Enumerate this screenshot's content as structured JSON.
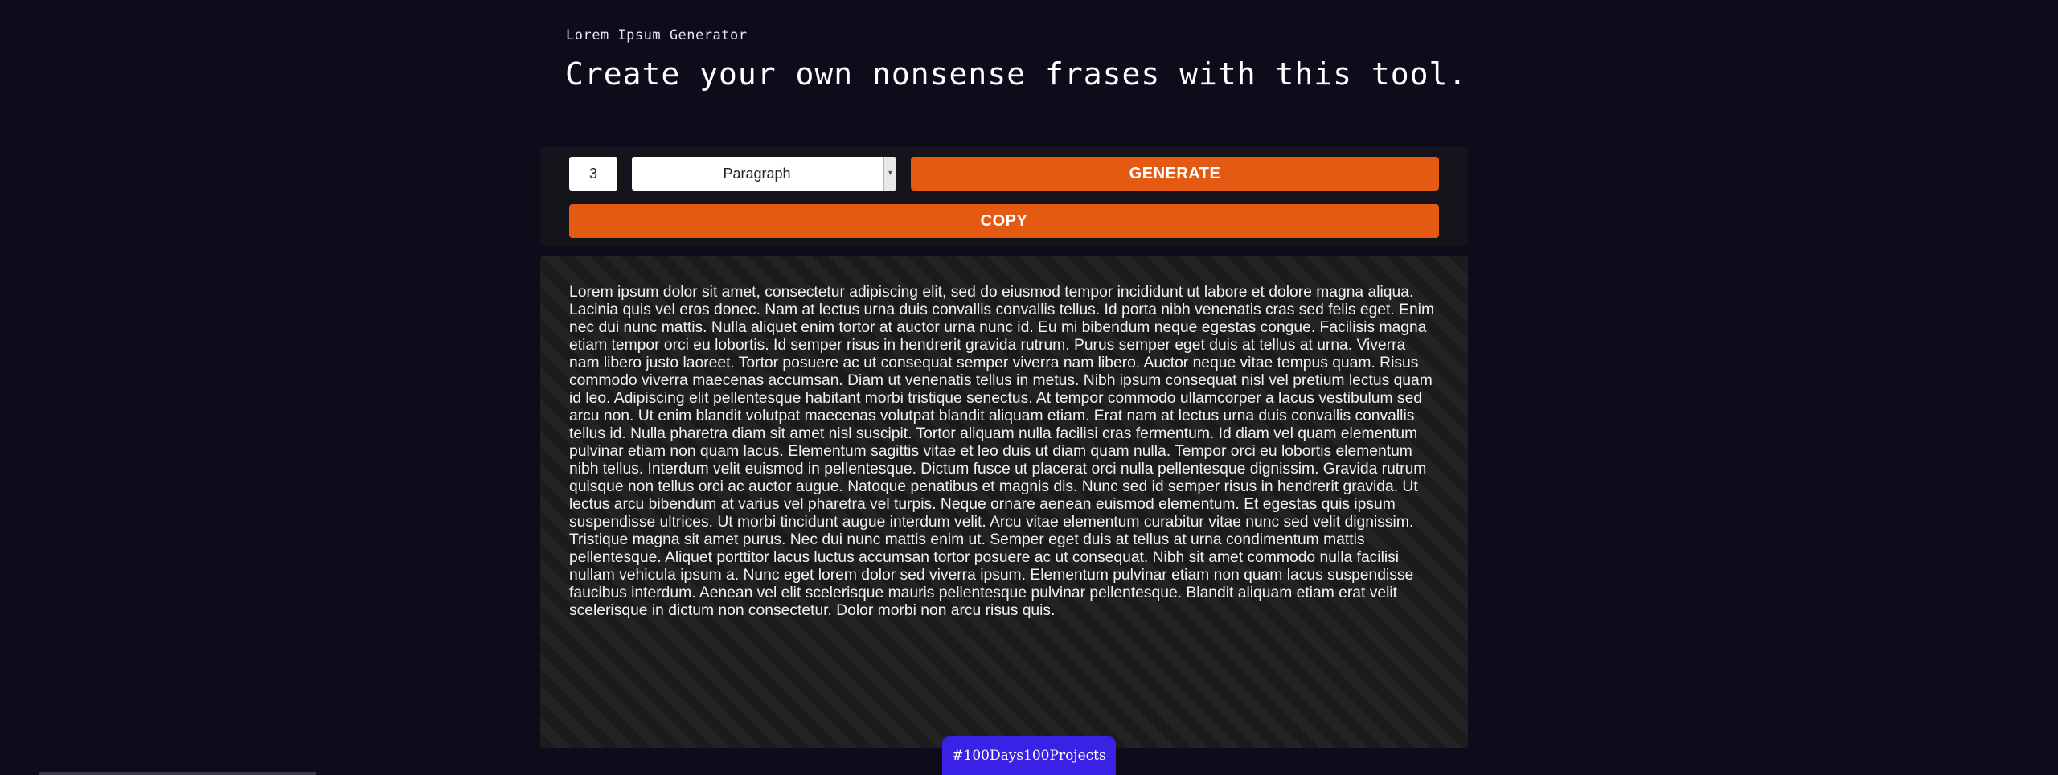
{
  "header": {
    "app_label": "Lorem Ipsum Generator",
    "title": "Create your own nonsense frases with this tool."
  },
  "controls": {
    "count_value": "3",
    "type_selected": "Paragraph",
    "generate_label": "GENERATE",
    "copy_label": "COPY"
  },
  "output": {
    "text": "Lorem ipsum dolor sit amet, consectetur adipiscing elit, sed do eiusmod tempor incididunt ut labore et dolore magna aliqua. Lacinia quis vel eros donec. Nam at lectus urna duis convallis convallis tellus. Id porta nibh venenatis cras sed felis eget. Enim nec dui nunc mattis. Nulla aliquet enim tortor at auctor urna nunc id. Eu mi bibendum neque egestas congue. Facilisis magna etiam tempor orci eu lobortis. Id semper risus in hendrerit gravida rutrum. Purus semper eget duis at tellus at urna. Viverra nam libero justo laoreet. Tortor posuere ac ut consequat semper viverra nam libero. Auctor neque vitae tempus quam. Risus commodo viverra maecenas accumsan. Diam ut venenatis tellus in metus. Nibh ipsum consequat nisl vel pretium lectus quam id leo. Adipiscing elit pellentesque habitant morbi tristique senectus. At tempor commodo ullamcorper a lacus vestibulum sed arcu non. Ut enim blandit volutpat maecenas volutpat blandit aliquam etiam. Erat nam at lectus urna duis convallis convallis tellus id. Nulla pharetra diam sit amet nisl suscipit. Tortor aliquam nulla facilisi cras fermentum. Id diam vel quam elementum pulvinar etiam non quam lacus. Elementum sagittis vitae et leo duis ut diam quam nulla. Tempor orci eu lobortis elementum nibh tellus. Interdum velit euismod in pellentesque. Dictum fusce ut placerat orci nulla pellentesque dignissim. Gravida rutrum quisque non tellus orci ac auctor augue. Natoque penatibus et magnis dis. Nunc sed id semper risus in hendrerit gravida. Ut lectus arcu bibendum at varius vel pharetra vel turpis. Neque ornare aenean euismod elementum. Et egestas quis ipsum suspendisse ultrices. Ut morbi tincidunt augue interdum velit. Arcu vitae elementum curabitur vitae nunc sed velit dignissim. Tristique magna sit amet purus. Nec dui nunc mattis enim ut. Semper eget duis at tellus at urna condimentum mattis pellentesque. Aliquet porttitor lacus luctus accumsan tortor posuere ac ut consequat. Nibh sit amet commodo nulla facilisi nullam vehicula ipsum a. Nunc eget lorem dolor sed viverra ipsum. Elementum pulvinar etiam non quam lacus suspendisse faucibus interdum. Aenean vel elit scelerisque mauris pellentesque pulvinar pellentesque. Blandit aliquam etiam erat velit scelerisque in dictum non consectetur. Dolor morbi non arcu risus quis."
  },
  "footer": {
    "badge_label": "#100Days100Projects"
  },
  "colors": {
    "background": "#0f0b1b",
    "accent": "#e55a13",
    "badge": "#3a21e6"
  }
}
